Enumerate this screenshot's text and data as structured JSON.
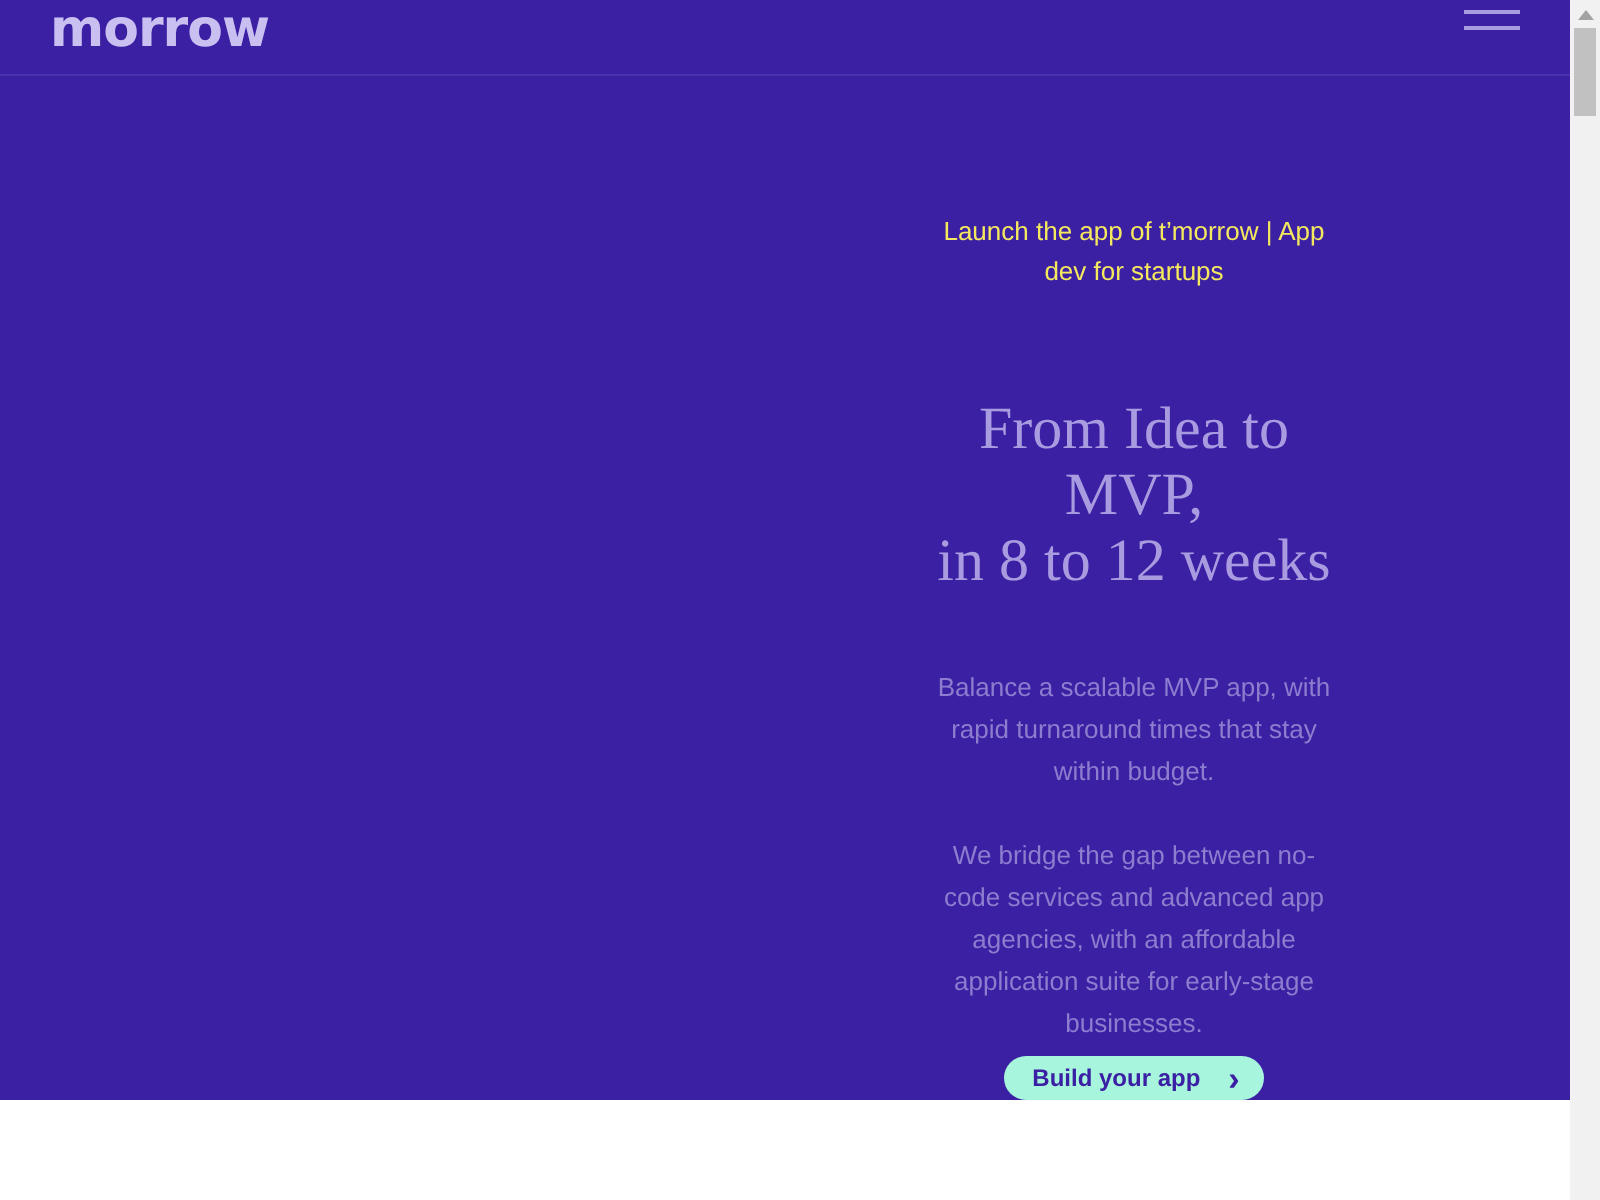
{
  "header": {
    "logo": "morrow"
  },
  "hero": {
    "tagline": "Launch the app of t’morrow | App dev for startups",
    "headline_lines": [
      "From Idea to",
      "MVP,",
      "in 8 to 12 weeks"
    ],
    "paragraphs": [
      "Balance a scalable MVP app, with rapid turnaround times that stay within budget.",
      "We bridge the gap between no-code services and advanced app agencies, with an affordable application suite for early-stage businesses."
    ],
    "button": {
      "label": "Build your app",
      "icon": "›"
    }
  }
}
